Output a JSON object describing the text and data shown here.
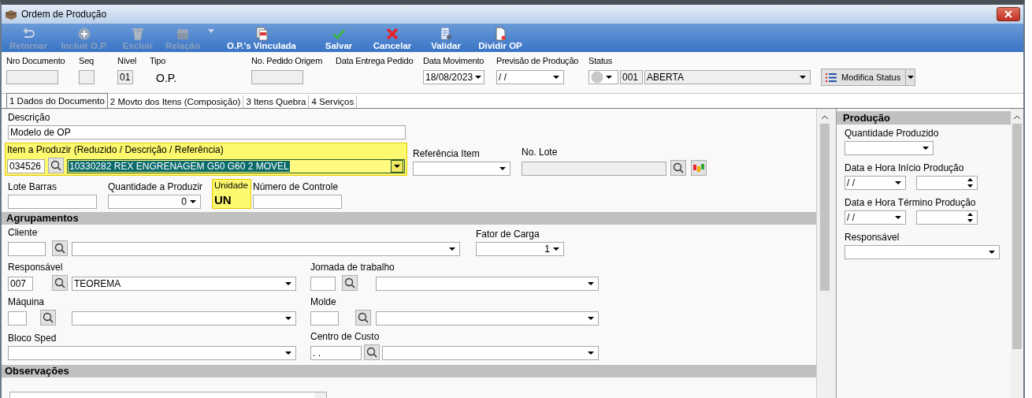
{
  "window": {
    "title": "Ordem de Produção"
  },
  "toolbar": [
    {
      "label": "Retornar",
      "disabled": true
    },
    {
      "label": "Incluir O.P.",
      "disabled": true
    },
    {
      "label": "Excluir",
      "disabled": true
    },
    {
      "label": "Relação",
      "disabled": true,
      "menu": true
    },
    {
      "label": "O.P.'s Vinculada",
      "disabled": false
    },
    {
      "label": "Salvar",
      "disabled": false
    },
    {
      "label": "Cancelar",
      "disabled": false
    },
    {
      "label": "Validar",
      "disabled": false
    },
    {
      "label": "Dividir OP",
      "disabled": false
    }
  ],
  "header": [
    {
      "label": "Nro Documento",
      "kind": "input",
      "disabled": true
    },
    {
      "label": "Seq",
      "kind": "input",
      "disabled": true
    },
    {
      "label": "Nível",
      "kind": "input",
      "value": "01",
      "disabled": true
    },
    {
      "label": "Tipo",
      "kind": "text",
      "value": "O.P."
    },
    {
      "label": "No. Pedido Origem",
      "kind": "input",
      "disabled": true
    },
    {
      "label": "Data Entrega Pedido",
      "kind": "label"
    },
    {
      "label": "Data Movimento",
      "kind": "combo",
      "value": "18/08/2023"
    },
    {
      "label": "Previsão de Produção",
      "kind": "combo",
      "value": " / /"
    },
    {
      "label": "Status",
      "kind": "status",
      "code": "001",
      "value": "ABERTA"
    }
  ],
  "status_button": {
    "label": "Modifica Status"
  },
  "tabs": [
    {
      "label": "1 Dados do Documento",
      "selected": true
    },
    {
      "label": "2 Movto dos Itens (Composição)",
      "selected": false
    },
    {
      "label": "3 Itens Quebra",
      "selected": false
    },
    {
      "label": "4 Serviços",
      "selected": false
    }
  ],
  "document": {
    "descricao": {
      "label": "Descrição",
      "value": "Modelo de OP"
    },
    "item": {
      "label": "Item a Produzir (Reduzido / Descrição / Referência)",
      "code": "034526",
      "value": "10330282 REX ENGRENAGEM G50 G60 2 MOVEL",
      "highlighted": true
    },
    "referencia_item": {
      "label": "Referência Item"
    },
    "no_lote": {
      "label": "No. Lote"
    },
    "lote_barras": {
      "label": "Lote Barras"
    },
    "quantidade": {
      "label": "Quantidade a Produzir",
      "value": "0"
    },
    "unidade": {
      "label": "Unidade",
      "value": "UN",
      "highlighted": true
    },
    "numero_controle": {
      "label": "Número de Controle"
    }
  },
  "agrupamentos": {
    "title": "Agrupamentos",
    "cliente": {
      "label": "Cliente"
    },
    "fator_carga": {
      "label": "Fator de Carga",
      "value": "1"
    },
    "responsavel": {
      "label": "Responsável",
      "code": "007",
      "value": "TEOREMA"
    },
    "jornada": {
      "label": "Jornada de trabalho"
    },
    "maquina": {
      "label": "Máquina"
    },
    "molde": {
      "label": "Molde"
    },
    "bloco_sped": {
      "label": "Bloco Sped"
    },
    "centro_custo": {
      "label": "Centro de Custo",
      "code": " .  ."
    }
  },
  "observacoes": {
    "title": "Observações"
  },
  "producao": {
    "title": "Produção",
    "quantidade": {
      "label": "Quantidade Produzido"
    },
    "inicio": {
      "label": "Data e Hora Início Produção",
      "date": " / /"
    },
    "termino": {
      "label": "Data e Hora Término Produção",
      "date": " / /"
    },
    "responsavel": {
      "label": "Responsável"
    }
  }
}
